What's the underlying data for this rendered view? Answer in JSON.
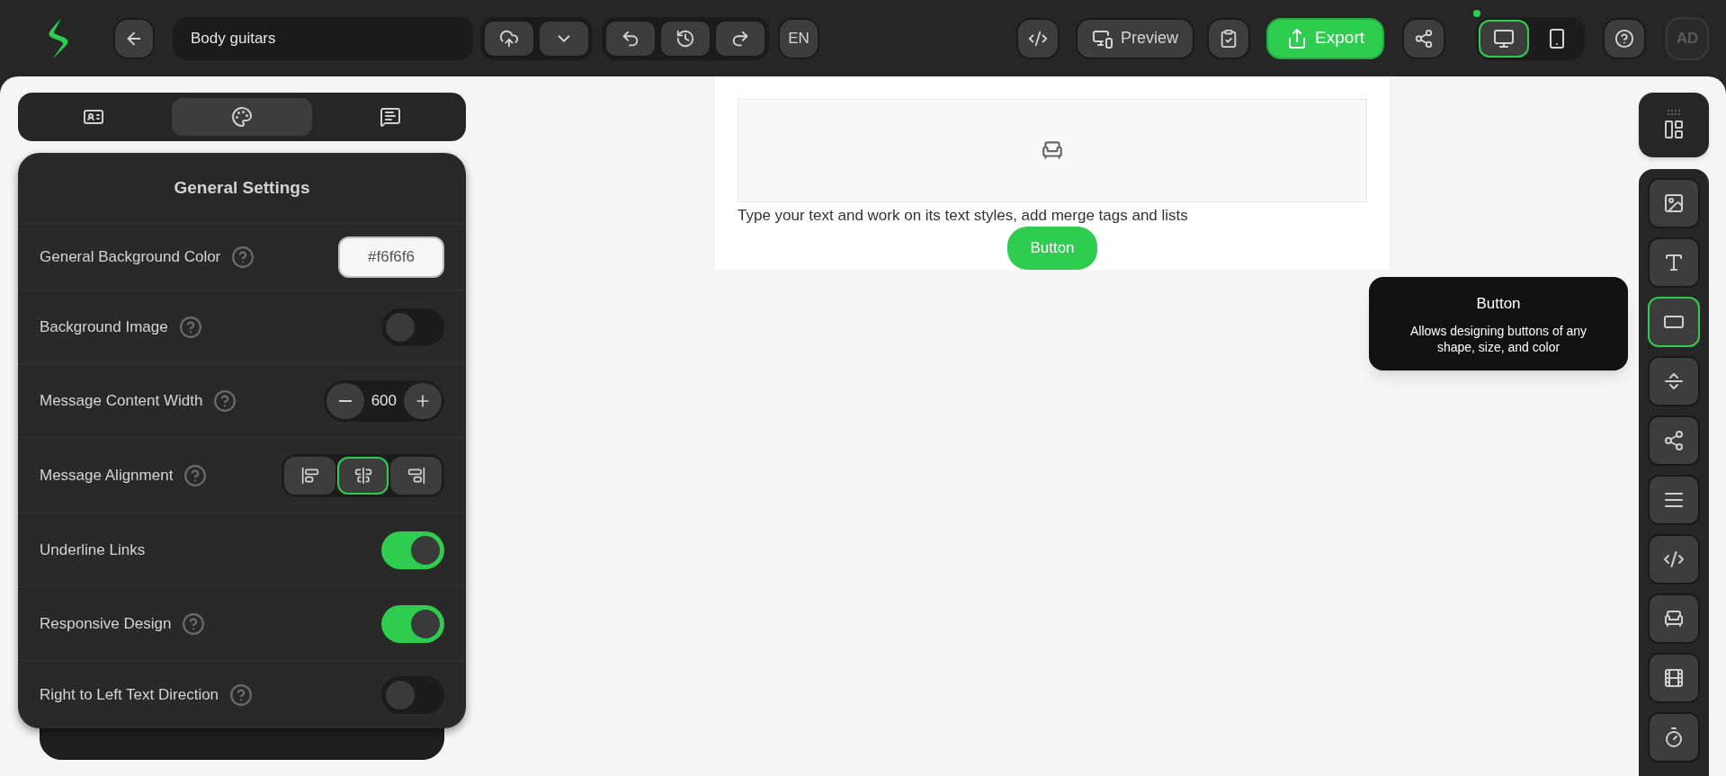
{
  "topbar": {
    "document_title": "Body guitars",
    "language": "EN",
    "preview": "Preview",
    "export": "Export",
    "avatar": "AD",
    "devices": [
      {
        "kind": "desktop",
        "selected": true
      },
      {
        "kind": "mobile",
        "selected": false
      }
    ]
  },
  "panel_tabs": [
    {
      "kind": "layout",
      "selected": false
    },
    {
      "kind": "style",
      "selected": true
    },
    {
      "kind": "comments",
      "selected": false
    }
  ],
  "settings": {
    "title": "General Settings",
    "rows": [
      {
        "kind": "color",
        "label": "General Background Color",
        "help": true,
        "value": "#f6f6f6"
      },
      {
        "kind": "toggle",
        "label": "Background Image",
        "help": true,
        "on": false
      },
      {
        "kind": "stepper",
        "label": "Message Content Width",
        "help": true,
        "value": "600"
      },
      {
        "kind": "alignment",
        "label": "Message Alignment",
        "help": true,
        "options": [
          {
            "kind": "left",
            "selected": false
          },
          {
            "kind": "center",
            "selected": true
          },
          {
            "kind": "right",
            "selected": false
          }
        ]
      },
      {
        "kind": "toggle",
        "label": "Underline Links",
        "help": false,
        "on": true
      },
      {
        "kind": "toggle",
        "label": "Responsive Design",
        "help": true,
        "on": true
      },
      {
        "kind": "toggle",
        "label": "Right to Left Text Direction",
        "help": true,
        "on": false
      }
    ]
  },
  "email": {
    "text": "Type your text and work on its text styles, add merge tags and lists",
    "button": "Button"
  },
  "tools": [
    {
      "kind": "image",
      "selected": false
    },
    {
      "kind": "text",
      "selected": false
    },
    {
      "kind": "button",
      "selected": true
    },
    {
      "kind": "spacer",
      "selected": false
    },
    {
      "kind": "social",
      "selected": false
    },
    {
      "kind": "divider",
      "selected": false
    },
    {
      "kind": "html",
      "selected": false
    },
    {
      "kind": "seat",
      "selected": false
    },
    {
      "kind": "video",
      "selected": false
    },
    {
      "kind": "timer",
      "selected": false
    }
  ],
  "tooltip": {
    "title": "Button",
    "description": "Allows designing buttons of any shape, size, and color"
  }
}
